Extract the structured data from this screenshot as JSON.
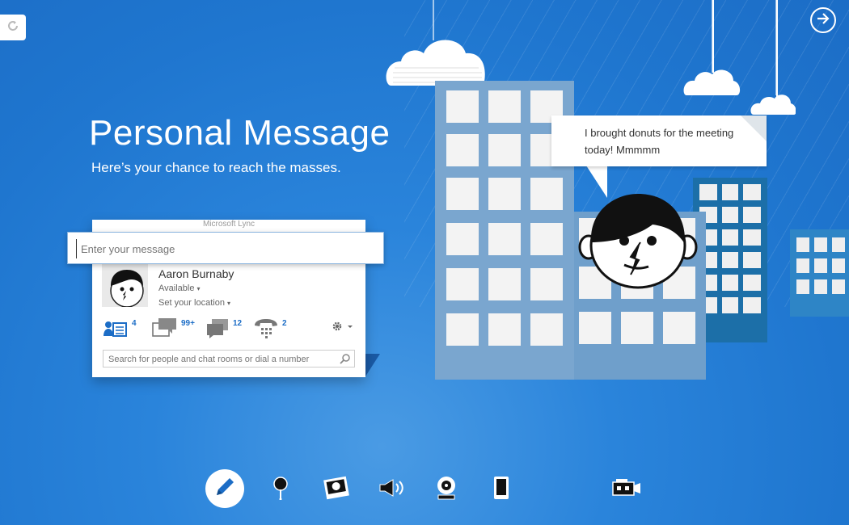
{
  "page": {
    "title": "Personal Message",
    "subtitle": "Here’s your chance to reach the masses."
  },
  "lync": {
    "window_title": "Microsoft Lync",
    "message_placeholder": "Enter your message",
    "user_name": "Aaron Burnaby",
    "status": "Available",
    "location": "Set your location",
    "counts": {
      "contacts": "4",
      "conversations": "99+",
      "chats": "12",
      "calls": "2"
    },
    "search_placeholder": "Search for people and chat rooms or dial a number"
  },
  "illustration": {
    "speech_bubble": "I brought donuts for the meeting today! Mmmmm"
  },
  "toolbar": {
    "tools": [
      "pencil",
      "location-pin",
      "photo",
      "speaker",
      "webcam",
      "mobile-phone",
      "video-camera"
    ]
  },
  "colors": {
    "background": "#1f76cf",
    "accent": "#1c6dc6",
    "presence_available": "#7bc043"
  }
}
